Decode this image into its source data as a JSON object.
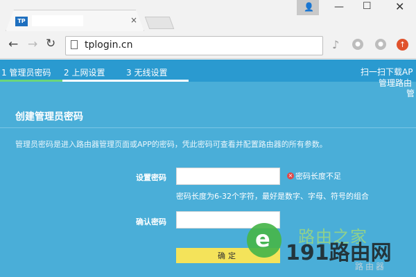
{
  "browser": {
    "tab_favicon_text": "TP",
    "tab_close": "×",
    "window_user": "👤",
    "window_min": "—",
    "window_max": "☐",
    "window_close": "✕",
    "nav_back": "←",
    "nav_forward": "→",
    "nav_reload": "↻",
    "url": "tplogin.cn",
    "ext_icons": [
      "voice-icon",
      "extension-icon",
      "extension-icon",
      "upload-icon"
    ]
  },
  "header": {
    "logo_partial": "管理员密码",
    "steps": [
      {
        "label": "1 管理员密码"
      },
      {
        "label": "2 上网设置"
      },
      {
        "label": "3 无线设置"
      }
    ],
    "progress_fraction": 0.33,
    "progress_color": "#6bd67a",
    "qr_line1": "扫一扫下载AP",
    "qr_line2": "管理路由",
    "qr_line3": "管"
  },
  "form": {
    "title": "创建管理员密码",
    "description": "管理员密码是进入路由器管理页面或APP的密码，凭此密码可查看并配置路由器的所有参数。",
    "password_label": "设置密码",
    "password_value": "",
    "error_icon": "×",
    "error_text": "密码长度不足",
    "hint": "密码长度为6-32个字符，最好是数字、字母、符号的组合",
    "confirm_label": "确认密码",
    "confirm_value": "",
    "submit_label": "确定"
  },
  "watermark": {
    "top": "路由之家",
    "bottom": "191路由网",
    "small": "路由器"
  },
  "colors": {
    "page_bg": "#4aaed8",
    "header_bg": "#2a9ad0",
    "button_bg": "#f4e35a",
    "error": "#e04848"
  }
}
